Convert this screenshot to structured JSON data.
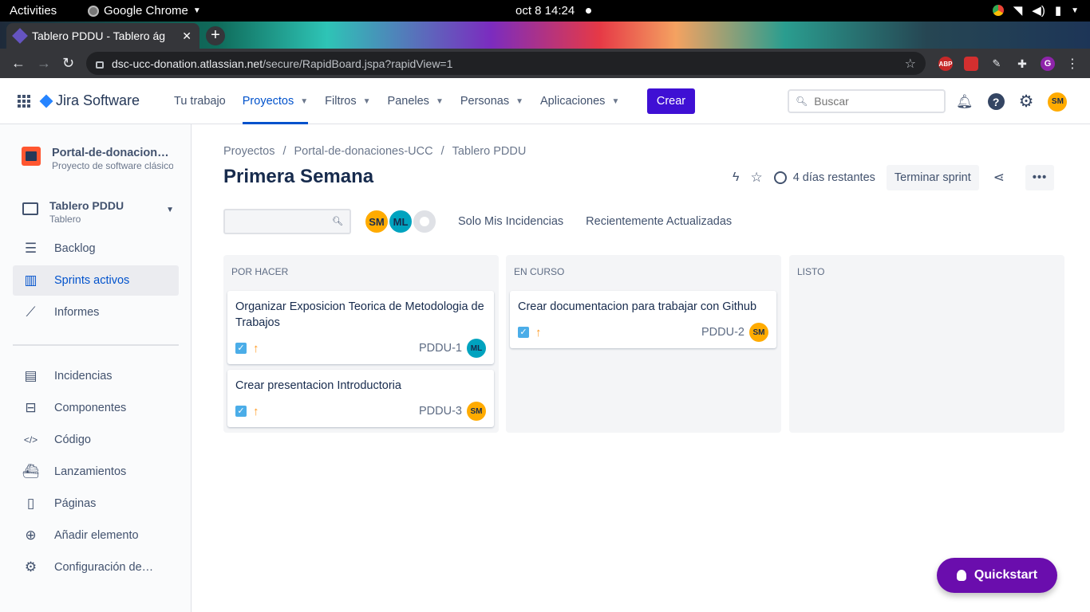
{
  "os": {
    "activities": "Activities",
    "app_name": "Google Chrome",
    "clock": "oct 8  14:24"
  },
  "browser": {
    "tab_title": "Tablero PDDU - Tablero ág",
    "url_host": "dsc-ucc-donation.atlassian.net",
    "url_path": "/secure/RapidBoard.jspa?rapidView=1",
    "extensions": [
      "ABP",
      "",
      "",
      "",
      "G"
    ]
  },
  "jira_nav": {
    "logo": "Jira Software",
    "menu": [
      {
        "label": "Tu trabajo",
        "dropdown": false,
        "active": false
      },
      {
        "label": "Proyectos",
        "dropdown": true,
        "active": true
      },
      {
        "label": "Filtros",
        "dropdown": true,
        "active": false
      },
      {
        "label": "Paneles",
        "dropdown": true,
        "active": false
      },
      {
        "label": "Personas",
        "dropdown": true,
        "active": false
      },
      {
        "label": "Aplicaciones",
        "dropdown": true,
        "active": false
      }
    ],
    "create_label": "Crear",
    "search_placeholder": "Buscar",
    "user_initials": "SM"
  },
  "sidebar": {
    "project_name": "Portal-de-donaciones-UCC",
    "project_type": "Proyecto de software clásico",
    "board_name": "Tablero PDDU",
    "board_sub": "Tablero",
    "items_top": [
      {
        "label": "Backlog",
        "icon": "backlog-icon"
      },
      {
        "label": "Sprints activos",
        "icon": "board-columns-icon",
        "active": true
      },
      {
        "label": "Informes",
        "icon": "chart-icon"
      }
    ],
    "items_bottom": [
      {
        "label": "Incidencias",
        "icon": "issues-icon"
      },
      {
        "label": "Componentes",
        "icon": "components-icon"
      },
      {
        "label": "Código",
        "icon": "code-icon"
      },
      {
        "label": "Lanzamientos",
        "icon": "ship-icon"
      },
      {
        "label": "Páginas",
        "icon": "page-icon"
      },
      {
        "label": "Añadir elemento",
        "icon": "add-item-icon"
      },
      {
        "label": "Configuración de proyecto",
        "icon": "gear-icon"
      }
    ]
  },
  "board": {
    "breadcrumbs": [
      "Proyectos",
      "Portal-de-donaciones-UCC",
      "Tablero PDDU"
    ],
    "title": "Primera Semana",
    "remaining": "4 días restantes",
    "complete_sprint": "Terminar sprint",
    "quick_filters": [
      "Solo Mis Incidencias",
      "Recientemente Actualizadas"
    ],
    "avatars": [
      {
        "initials": "SM",
        "color": "#ffab00"
      },
      {
        "initials": "ML",
        "color": "#00a3bf"
      }
    ],
    "columns": [
      {
        "name": "POR HACER",
        "cards": [
          {
            "title": "Organizar Exposicion Teorica de Metodologia de Trabajos",
            "key": "PDDU-1",
            "assignee": "ML",
            "assignee_color": "#00a3bf"
          },
          {
            "title": "Crear presentacion Introductoria",
            "key": "PDDU-3",
            "assignee": "SM",
            "assignee_color": "#ffab00"
          }
        ]
      },
      {
        "name": "EN CURSO",
        "cards": [
          {
            "title": "Crear documentacion para trabajar con Github",
            "key": "PDDU-2",
            "assignee": "SM",
            "assignee_color": "#ffab00"
          }
        ]
      },
      {
        "name": "LISTO",
        "cards": []
      }
    ]
  },
  "quickstart_label": "Quickstart",
  "colors": {
    "accent": "#0052cc",
    "create_button": "#3f10d4",
    "quickstart": "#6a0dad",
    "priority": "#ff991f"
  }
}
